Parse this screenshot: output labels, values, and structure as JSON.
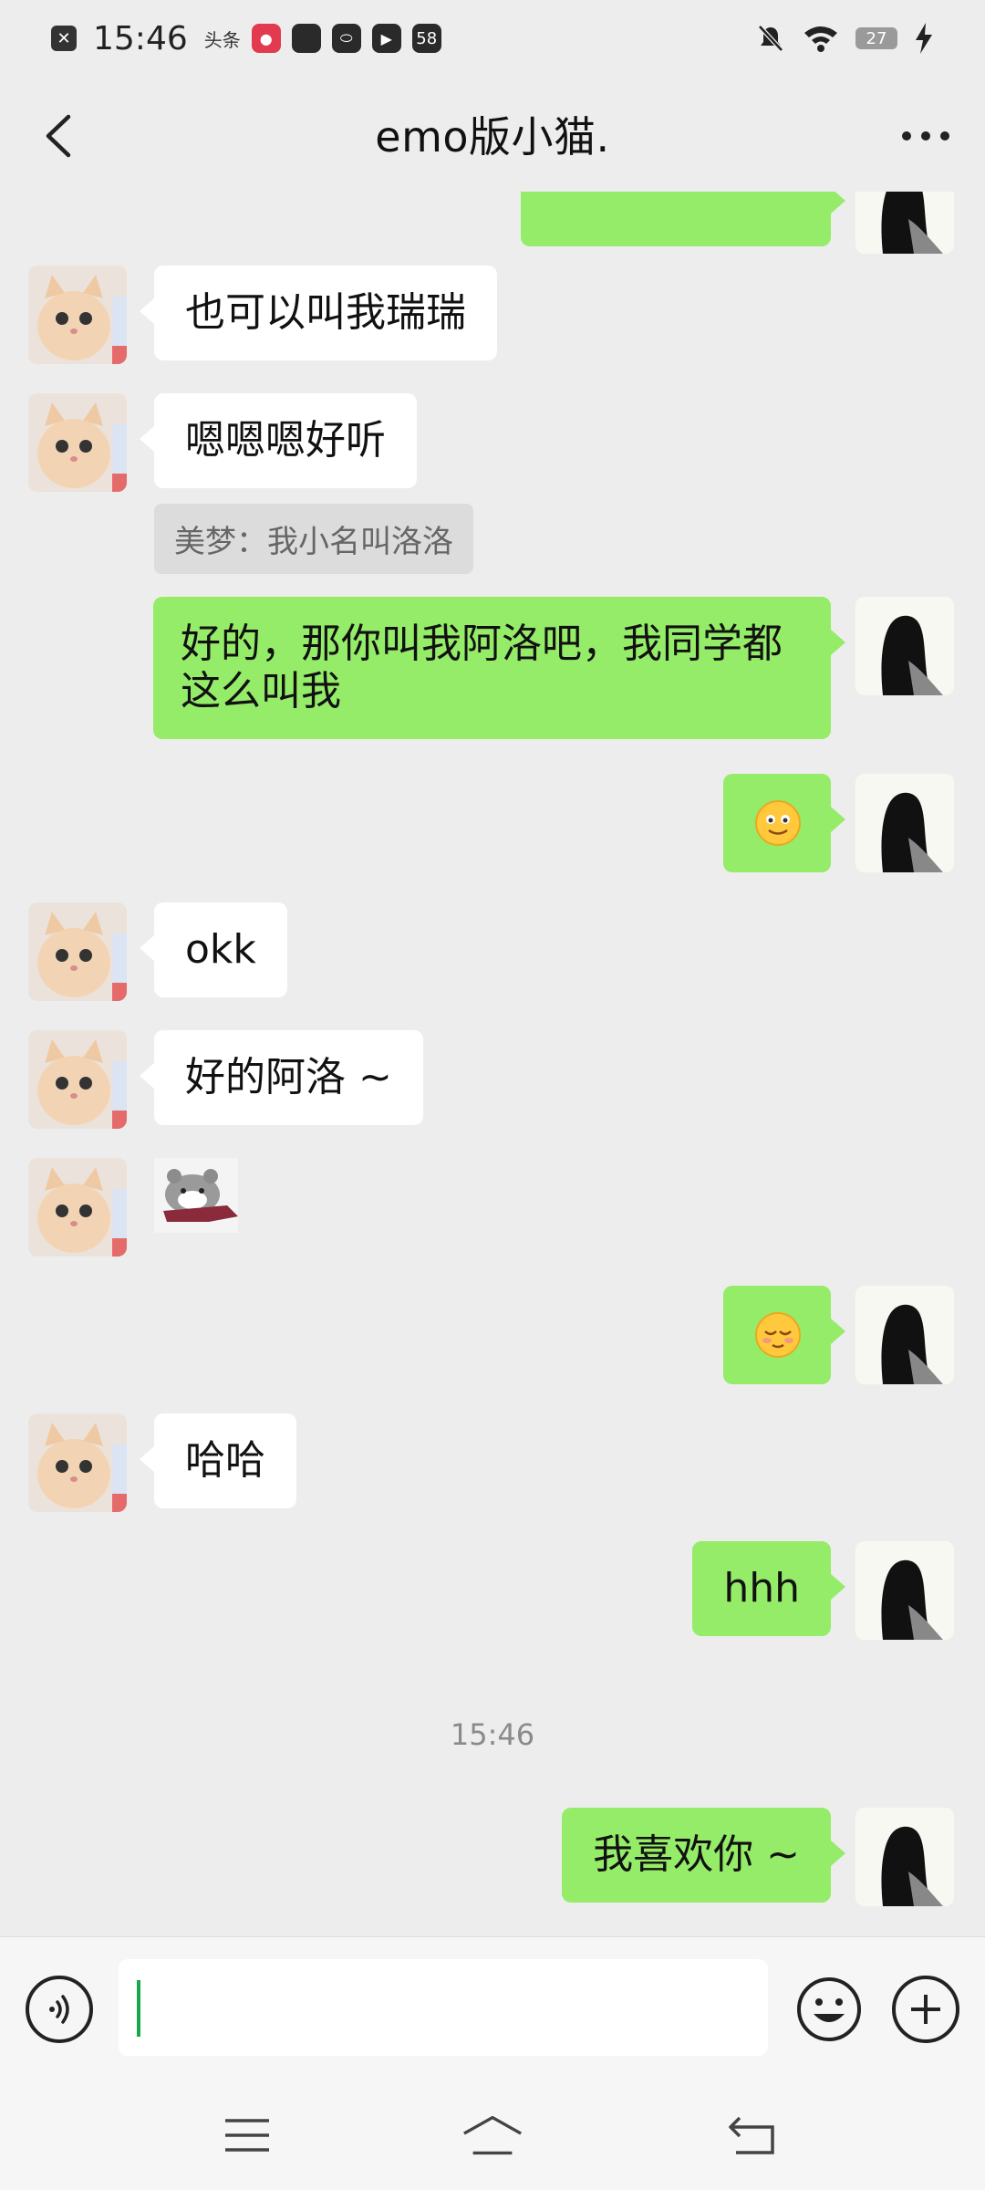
{
  "status_bar": {
    "time": "15:46",
    "notif_icons": [
      "x-icon",
      "toutiao-icon",
      "record-icon",
      "square-icon",
      "leaf-icon",
      "play-icon"
    ],
    "badge_58": "58",
    "toutiao_label": "头条",
    "battery_level": "27"
  },
  "header": {
    "title": "emo版小猫."
  },
  "messages": [
    {
      "side": "in",
      "text": "也可以叫我瑞瑞"
    },
    {
      "side": "in",
      "text": "嗯嗯嗯好听"
    },
    {
      "quote": "美梦：我小名叫洛洛"
    },
    {
      "side": "out",
      "line1": "好的，那你叫我阿洛吧，我同学都",
      "line2": "这么叫我"
    },
    {
      "side": "out",
      "emoji": "slight-smile-emoji"
    },
    {
      "side": "in",
      "text": "okk"
    },
    {
      "side": "in",
      "text": "好的阿洛 ~"
    },
    {
      "side": "in",
      "sticker": "hamster-sticker"
    },
    {
      "side": "out",
      "emoji": "relieved-emoji"
    },
    {
      "side": "in",
      "text": "哈哈"
    },
    {
      "side": "out",
      "text": "hhh"
    },
    {
      "side": "out",
      "text": "我喜欢你 ~"
    }
  ],
  "timestamp": "15:46",
  "input": {
    "value": "",
    "placeholder": ""
  },
  "colors": {
    "background": "#ededed",
    "outgoing_bubble": "#95ec69",
    "incoming_bubble": "#ffffff",
    "caret": "#18a84a"
  }
}
